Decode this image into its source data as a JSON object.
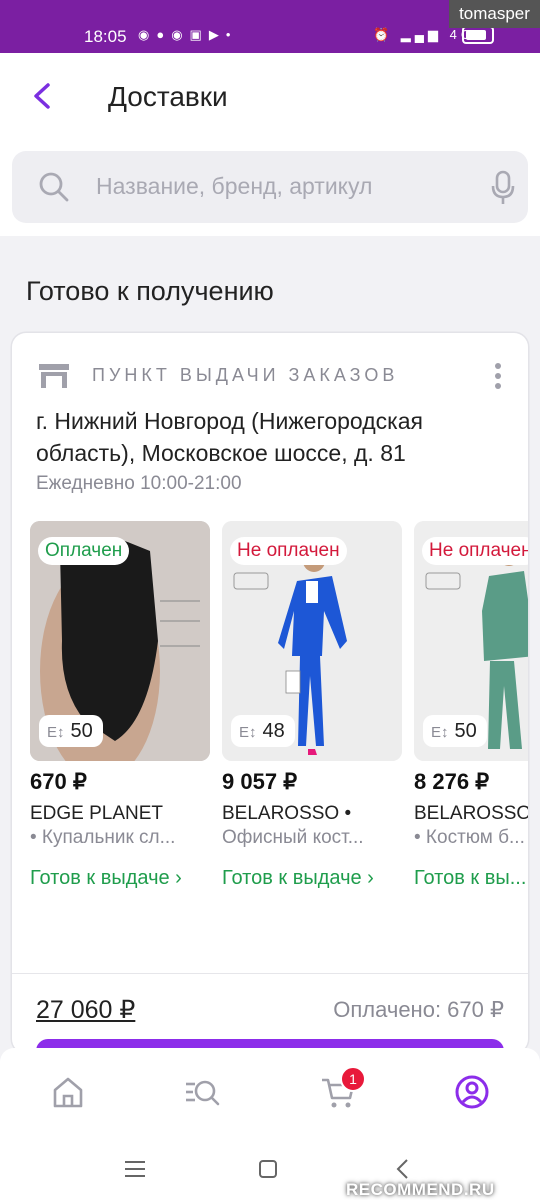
{
  "status_bar": {
    "time": "18:05",
    "app_icons": [
      "viber-icon",
      "message-icon",
      "whatsapp-icon",
      "chat-icon",
      "youtube-icon",
      "dot-icon"
    ],
    "network": "4G",
    "icons": [
      "alarm-icon",
      "signal-icon",
      "signal-4g-icon",
      "battery-icon"
    ]
  },
  "watermarks": {
    "top": "tomasper",
    "bottom": "RECOMMEND.RU"
  },
  "header": {
    "title": "Доставки"
  },
  "search": {
    "placeholder": "Название, бренд, артикул"
  },
  "section_title": "Готово к получению",
  "pickup": {
    "label": "ПУНКТ ВЫДАЧИ ЗАКАЗОВ",
    "address": "г. Нижний Новгород (Нижегородская область), Московское шоссе, д. 81",
    "hours": "Ежедневно 10:00-21:00"
  },
  "products": [
    {
      "badge": "Оплачен",
      "paid": true,
      "size": "50",
      "price": "670 ₽",
      "brand": "EDGE PLANET",
      "desc": "• Купальник сл...",
      "status": "Готов к выдаче ›"
    },
    {
      "badge": "Не оплачен",
      "paid": false,
      "size": "48",
      "price": "9 057 ₽",
      "brand": "BELAROSSO •",
      "desc": "Офисный кост...",
      "status": "Готов к выдаче ›"
    },
    {
      "badge": "Не оплачен",
      "paid": false,
      "size": "50",
      "price": "8 276 ₽",
      "brand": "BELAROSSO",
      "desc": "• Костюм б...",
      "status": "Готов к вы..."
    }
  ],
  "summary": {
    "total": "27 060 ₽",
    "paid": "Оплачено: 670 ₽"
  },
  "bottom_nav": {
    "cart_count": "1",
    "colors": {
      "accent": "#8c2dea",
      "inactive": "#a0a0aa",
      "badge": "#e8193a"
    }
  },
  "colors": {
    "header_bar": "#7b1fa2",
    "paid_green": "#1f9d4c",
    "unpaid_red": "#d3193b"
  }
}
